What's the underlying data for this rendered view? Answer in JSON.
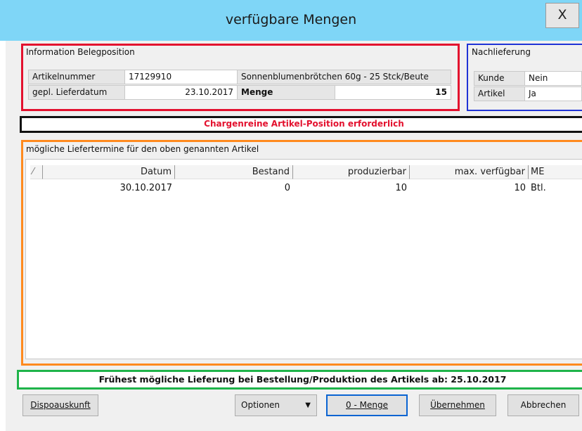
{
  "window": {
    "title": "verfügbare Mengen",
    "close_label": "X"
  },
  "beleg": {
    "title": "Information Belegposition",
    "artikelnummer_label": "Artikelnummer",
    "artikelnummer": "17129910",
    "artikel_bezeichnung": "Sonnenblumenbrötchen 60g - 25 Stck/Beute",
    "liefer_label": "gepl. Lieferdatum",
    "lieferdatum": "23.10.2017",
    "menge_label": "Menge",
    "menge": "15"
  },
  "nach": {
    "title": "Nachlieferung",
    "kunde_label": "Kunde",
    "kunde_value": "Nein",
    "artikel_label": "Artikel",
    "artikel_value": "Ja"
  },
  "warning": "Chargenreine Artikel-Position erforderlich",
  "liefertermine": {
    "title": "mögliche Liefertermine für den oben genannten Artikel",
    "columns": [
      "Datum",
      "Bestand",
      "produzierbar",
      "max. verfügbar",
      "ME"
    ],
    "rows": [
      [
        "30.10.2017",
        "0",
        "10",
        "10",
        "Btl."
      ]
    ]
  },
  "earliest": "Frühest mögliche Lieferung bei Bestellung/Produktion des Artikels ab: 25.10.2017",
  "buttons": {
    "dispo": "Dispoauskunft",
    "optionen": "Optionen",
    "null_menge": "0 - Menge",
    "uebernehmen": "Übernehmen",
    "abbrechen": "Abbrechen"
  },
  "colors": {
    "titlebar": "#7fd6f7",
    "warning_text": "#e3112e",
    "beleg_frame": "#e3112e",
    "nach_frame": "#1f33d6",
    "termine_frame": "#ff8a1e",
    "earliest_frame": "#1fb44a"
  }
}
